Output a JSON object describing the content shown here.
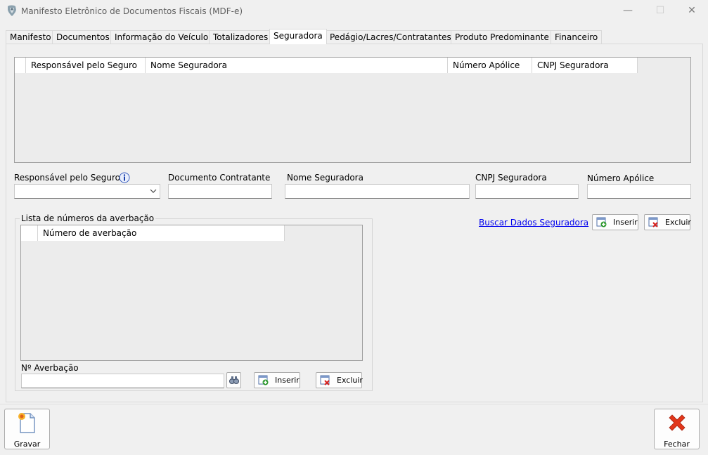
{
  "window": {
    "title": "Manifesto Eletrônico de Documentos Fiscais (MDF-e)",
    "minimize_glyph": "—",
    "maximize_glyph": "☐",
    "close_glyph": "✕"
  },
  "tabs": [
    {
      "label": "Manifesto"
    },
    {
      "label": "Documentos"
    },
    {
      "label": "Informação do Veículo"
    },
    {
      "label": "Totalizadores"
    },
    {
      "label": "Seguradora",
      "active": true
    },
    {
      "label": "Pedágio/Lacres/Contratantes"
    },
    {
      "label": "Produto Predominante"
    },
    {
      "label": "Financeiro"
    }
  ],
  "seguros_grid": {
    "columns": [
      "Responsável pelo Seguro",
      "Nome Seguradora",
      "Número Apólice",
      "CNPJ Seguradora"
    ],
    "rows": []
  },
  "form": {
    "responsavel_label": "Responsável pelo Seguro",
    "responsavel_value": "",
    "documento_label": "Documento Contratante",
    "documento_value": "",
    "nome_label": "Nome Seguradora",
    "nome_value": "",
    "cnpj_label": "CNPJ Seguradora",
    "cnpj_value": "",
    "apolice_label": "Número Apólice",
    "apolice_value": ""
  },
  "seguradora_actions": {
    "buscar_link": "Buscar Dados Seguradora",
    "inserir": "Inserir",
    "excluir": "Excluir"
  },
  "averbacao": {
    "group_title": "Lista de números da averbação",
    "column": "Número de averbação",
    "rows": [],
    "field_label": "Nº Averbação",
    "field_value": "",
    "inserir": "Inserir",
    "excluir": "Excluir"
  },
  "footer": {
    "gravar": "Gravar",
    "fechar": "Fechar"
  },
  "colors": {
    "background": "#f0f0f0",
    "link": "#0000ee",
    "close_red": "#e2361a"
  }
}
